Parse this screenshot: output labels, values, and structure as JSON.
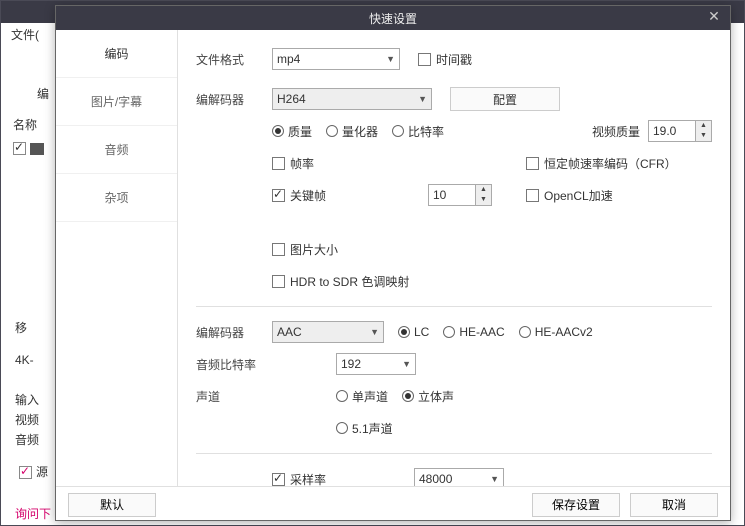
{
  "app": {
    "menu_file": "文件(",
    "left_col_header1": "编",
    "left_name_header": "名称",
    "bg_label_move": "移",
    "bg_label_4k": "4K-",
    "bg_label_input": "输入",
    "bg_label_video": "视频",
    "bg_label_audio": "音频",
    "bg_label_src": "源",
    "bg_label_bottom": "询问下",
    "back_arrow": "<"
  },
  "dialog": {
    "title": "快速设置",
    "side": {
      "encode": "编码",
      "image_sub": "图片/字幕",
      "audio": "音频",
      "misc": "杂项"
    },
    "labels": {
      "file_format": "文件格式",
      "timestamp": "时间戳",
      "codec": "编解码器",
      "configure": "配置",
      "quality": "质量",
      "quantizer": "量化器",
      "bitrate": "比特率",
      "video_quality": "视频质量",
      "framerate": "帧率",
      "cfr": "恒定帧速率编码（CFR）",
      "keyframe": "关键帧",
      "opencl": "OpenCL加速",
      "image_size": "图片大小",
      "hdr_sdr": "HDR to SDR 色调映射",
      "audio_codec": "编解码器",
      "lc": "LC",
      "heaac": "HE-AAC",
      "heaacv2": "HE-AACv2",
      "audio_bitrate": "音频比特率",
      "channels": "声道",
      "mono": "单声道",
      "stereo": "立体声",
      "ch51": "5.1声道",
      "samplerate": "采样率"
    },
    "values": {
      "file_format": "mp4",
      "codec": "H264",
      "video_quality": "19.0",
      "keyframe": "10",
      "audio_codec": "AAC",
      "audio_bitrate": "192",
      "samplerate": "48000"
    },
    "footer": {
      "default": "默认",
      "save": "保存设置",
      "cancel": "取消"
    }
  }
}
